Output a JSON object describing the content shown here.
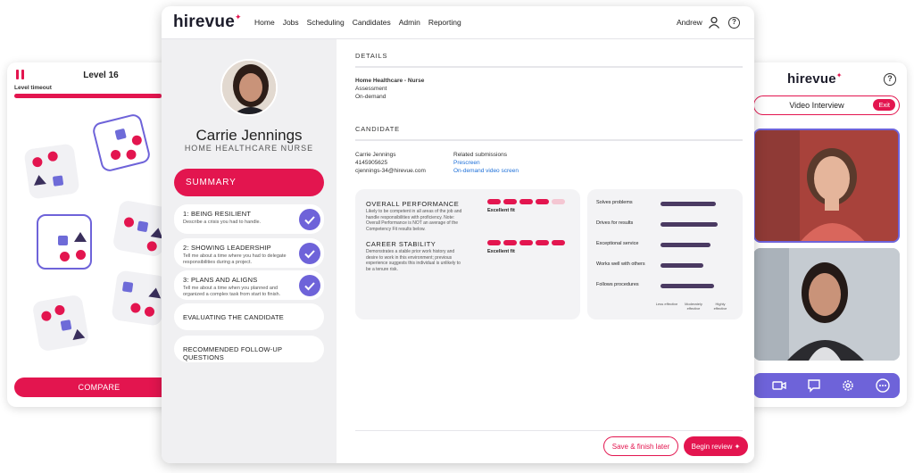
{
  "game": {
    "level": "Level 16",
    "timeout_label": "Level timeout",
    "timeout_progress": 0.95,
    "compare_label": "COMPARE"
  },
  "video": {
    "logo": "hirevue",
    "help": "?",
    "title": "Video Interview",
    "exit_label": "Exit",
    "toolbar_icons": [
      "video-icon",
      "chat-icon",
      "settings-icon",
      "more-icon"
    ]
  },
  "app": {
    "logo": "hirevue",
    "nav": [
      "Home",
      "Jobs",
      "Scheduling",
      "Candidates",
      "Admin",
      "Reporting"
    ],
    "user": "Andrew",
    "help": "?"
  },
  "candidate": {
    "name": "Carrie Jennings",
    "role": "HOME HEALTHCARE NURSE",
    "summary_label": "SUMMARY",
    "steps": [
      {
        "title": "1: BEING RESILIENT",
        "desc": "Describe a crisis you had to handle.",
        "checked": true
      },
      {
        "title": "2: SHOWING LEADERSHIP",
        "desc": "Tell me about a time where you had to delegate responsibilities during a project.",
        "checked": true
      },
      {
        "title": "3: PLANS AND ALIGNS",
        "desc": "Tell me about a time when you planned and organized a complex task from start to finish.",
        "checked": true
      },
      {
        "title": "EVALUATING THE CANDIDATE",
        "desc": "",
        "checked": false
      },
      {
        "title": "RECOMMENDED FOLLOW-UP QUESTIONS",
        "desc": "",
        "checked": false
      }
    ]
  },
  "details": {
    "label": "DETAILS",
    "job": "Home Healthcare - Nurse",
    "type": "Assessment",
    "mode": "On-demand"
  },
  "candidate_info": {
    "label": "CANDIDATE",
    "name": "Carrie Jennings",
    "phone": "4145905625",
    "email": "cjennings-34@hirevue.com",
    "related_label": "Related submissions",
    "related": [
      "Prescreen",
      "On-demand video screen"
    ]
  },
  "performance": {
    "overall_title": "OVERALL PERFORMANCE",
    "overall_desc": "Likely to be competent in all areas of the job and handle responsibilities with proficiency. Note: Overall Performance is NOT an average of the Competency Fit results below.",
    "overall_fit": "Excellent fit",
    "overall_score": 4,
    "career_title": "CAREER STABILITY",
    "career_desc": "Demonstrates a stable prior work history and desire to work in this environment; previous experience suggests this individual is unlikely to be a tenure risk.",
    "career_fit": "Excellent fit",
    "career_score": 5,
    "max_score": 5
  },
  "competencies": {
    "items": [
      {
        "label": "Solves problems",
        "value": 0.78
      },
      {
        "label": "Drives for results",
        "value": 0.8
      },
      {
        "label": "Exceptional service",
        "value": 0.7
      },
      {
        "label": "Works well with others",
        "value": 0.6
      },
      {
        "label": "Follows procedures",
        "value": 0.75
      }
    ],
    "scale": [
      "Less effective",
      "Moderately effective",
      "Highly effective"
    ]
  },
  "actions": {
    "save_label": "Save & finish later",
    "begin_label": "Begin review ✦"
  },
  "colors": {
    "accent": "#e3154f",
    "purple": "#6e63d9",
    "bar": "#4a3a62"
  }
}
